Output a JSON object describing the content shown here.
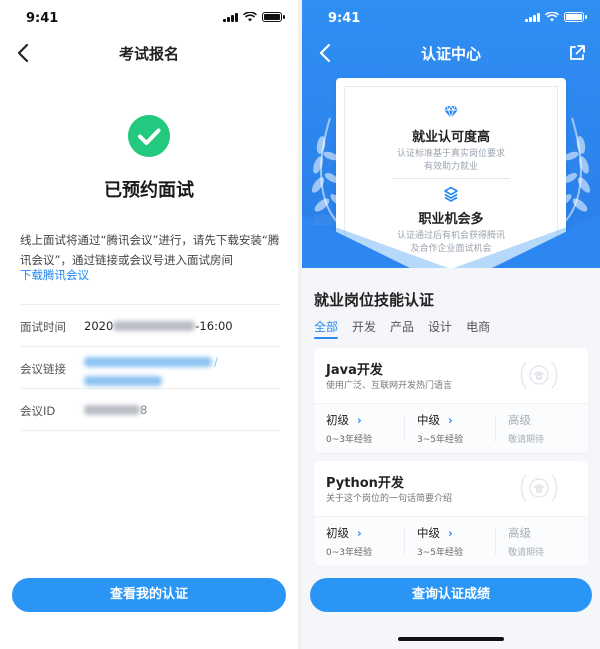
{
  "left": {
    "status_time": "9:41",
    "nav_title": "考试报名",
    "success_title": "已预约面试",
    "notice_text": "线上面试将通过“腾讯会议”进行，请先下载安装“腾讯会议”，通过链接或会议号进入面试房间",
    "download_link": "下载腾讯会议",
    "info": {
      "time_label": "面试时间",
      "time_prefix": "2020",
      "time_suffix": "-16:00",
      "link_label": "会议链接",
      "link_tail": "/",
      "id_label": "会议ID",
      "id_tail": "8"
    },
    "button_label": "查看我的认证"
  },
  "right": {
    "status_time": "9:41",
    "nav_title": "认证中心",
    "features": [
      {
        "icon": "diamond-icon",
        "title": "就业认可度高",
        "desc1": "认证标准基于真实岗位要求",
        "desc2": "有效助力就业"
      },
      {
        "icon": "layers-icon",
        "title": "职业机会多",
        "desc1": "认证通过后有机会获得腾讯",
        "desc2": "及合作企业面试机会"
      }
    ],
    "section_title": "就业岗位技能认证",
    "tabs": [
      "全部",
      "开发",
      "产品",
      "设计",
      "电商"
    ],
    "courses": [
      {
        "name": "Java开发",
        "desc": "使用广泛、互联网开发热门语言",
        "levels": [
          {
            "name": "初级",
            "exp": "0~3年经验"
          },
          {
            "name": "中级",
            "exp": "3~5年经验"
          },
          {
            "name": "高级",
            "exp": "敬请期待"
          }
        ]
      },
      {
        "name": "Python开发",
        "desc": "关于这个岗位的一句话简要介绍",
        "levels": [
          {
            "name": "初级",
            "exp": "0~3年经验"
          },
          {
            "name": "中级",
            "exp": "3~5年经验"
          },
          {
            "name": "高级",
            "exp": "敬请期待"
          }
        ]
      }
    ],
    "button_label": "查询认证成绩"
  },
  "colors": {
    "accent": "#2a95f5",
    "success": "#23c97f",
    "link": "#1f87f0",
    "hero_blue": "#2f8ff3"
  }
}
